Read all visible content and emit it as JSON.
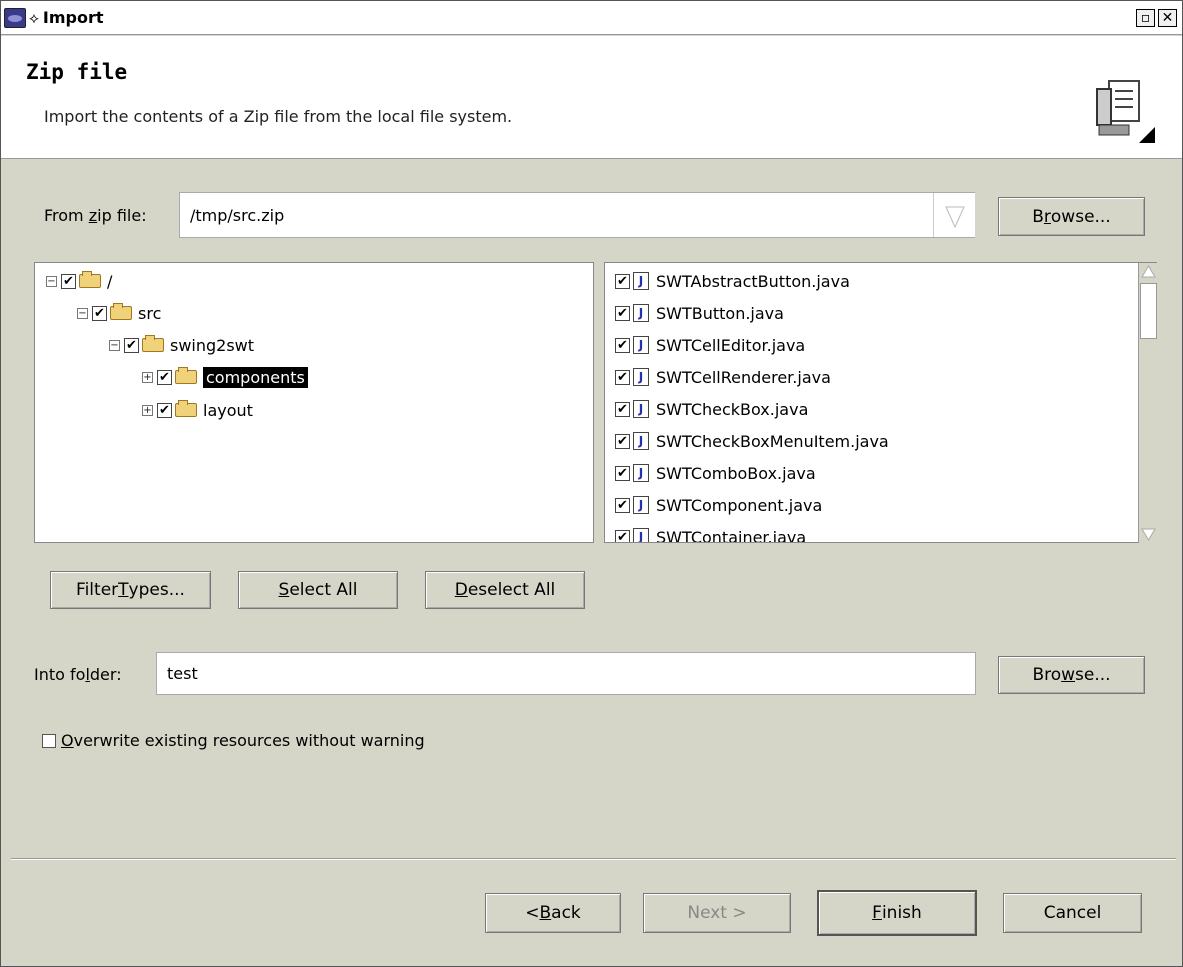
{
  "window": {
    "title": "Import",
    "pin_glyph": "⟡"
  },
  "header": {
    "title": "Zip file",
    "description": "Import the contents of a Zip file from the local file system.",
    "icon": "zip-import-icon"
  },
  "from_zip": {
    "label_pre": "From ",
    "label_u": "z",
    "label_post": "ip file:",
    "value": "/tmp/src.zip"
  },
  "browse1": {
    "pre": "B",
    "u": "r",
    "post": "owse..."
  },
  "tree": {
    "items": [
      {
        "label": "/",
        "expander": "−"
      },
      {
        "label": "src",
        "expander": "−"
      },
      {
        "label": "swing2swt",
        "expander": "−"
      },
      {
        "label": "components",
        "expander": "+"
      },
      {
        "label": "layout",
        "expander": "+"
      }
    ]
  },
  "files": [
    "SWTAbstractButton.java",
    "SWTButton.java",
    "SWTCellEditor.java",
    "SWTCellRenderer.java",
    "SWTCheckBox.java",
    "SWTCheckBoxMenuItem.java",
    "SWTComboBox.java",
    "SWTComponent.java",
    "SWTContainer.java"
  ],
  "buttons": {
    "filter": {
      "pre": "Filter ",
      "u": "T",
      "post": "ypes..."
    },
    "select_all": {
      "pre": "",
      "u": "S",
      "post": "elect All"
    },
    "deselect_all": {
      "pre": "",
      "u": "D",
      "post": "eselect All"
    }
  },
  "into_folder": {
    "label_pre": "Into fo",
    "label_u": "l",
    "label_post": "der:",
    "value": "test"
  },
  "browse2": {
    "pre": "Bro",
    "u": "w",
    "post": "se..."
  },
  "overwrite": {
    "pre": "",
    "u": "O",
    "post": "verwrite existing resources without warning",
    "checked": false
  },
  "footer": {
    "back": {
      "pre": "< ",
      "u": "B",
      "post": "ack"
    },
    "next": "Next >",
    "finish": {
      "pre": "",
      "u": "F",
      "post": "inish"
    },
    "cancel": "Cancel"
  },
  "glyphs": {
    "check": "✔",
    "j": "J",
    "close": "✕",
    "maximize": "▫"
  }
}
